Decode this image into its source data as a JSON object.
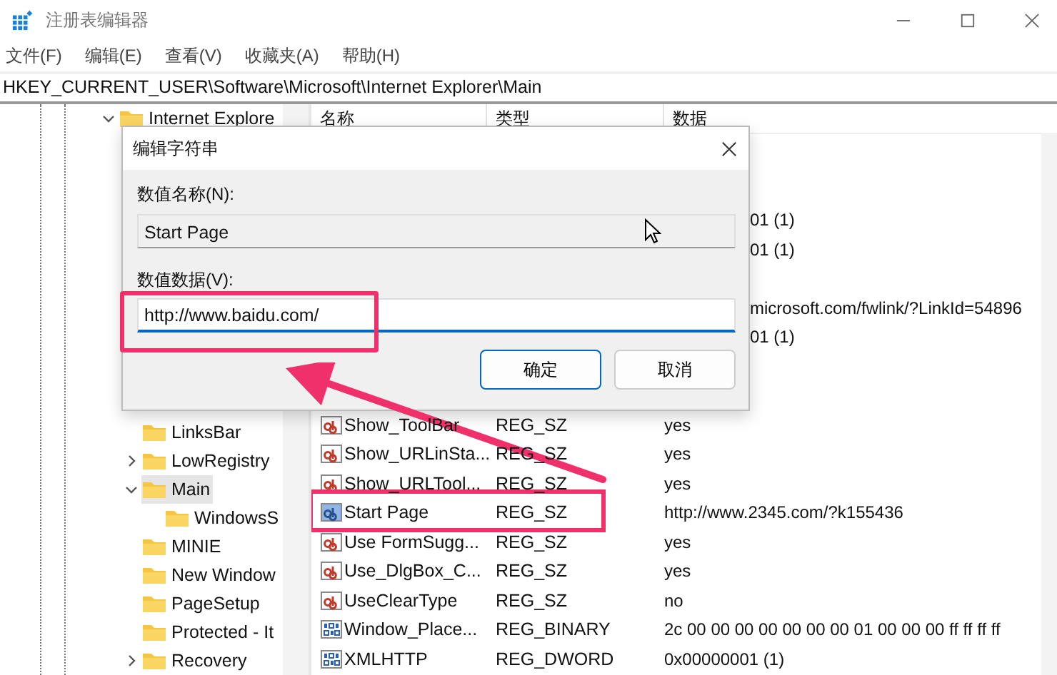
{
  "window": {
    "title": "注册表编辑器"
  },
  "menu": [
    "文件(F)",
    "编辑(E)",
    "查看(V)",
    "收藏夹(A)",
    "帮助(H)"
  ],
  "address": "HKEY_CURRENT_USER\\Software\\Microsoft\\Internet Explorer\\Main",
  "tree": [
    {
      "label": "Internet Explore",
      "expanded": true,
      "selected": false,
      "children": [
        {
          "label": "LinksBar",
          "selected": false
        },
        {
          "label": "LowRegistry",
          "expanded": false,
          "selected": false
        },
        {
          "label": "Main",
          "expanded": true,
          "selected": true,
          "children": [
            {
              "label": "WindowsS",
              "selected": false
            }
          ]
        },
        {
          "label": "MINIE",
          "selected": false
        },
        {
          "label": "New Window",
          "selected": false
        },
        {
          "label": "PageSetup",
          "selected": false
        },
        {
          "label": "Protected - It",
          "selected": false
        },
        {
          "label": "Recovery",
          "expanded": false,
          "selected": false
        }
      ]
    }
  ],
  "table": {
    "columns": [
      "名称",
      "类型",
      "数据"
    ],
    "rows": [
      {
        "kind": "covered"
      },
      {
        "kind": "covered"
      },
      {
        "kind": "partial",
        "data": "01 (1)"
      },
      {
        "kind": "partial",
        "data": "01 (1)"
      },
      {
        "kind": "covered"
      },
      {
        "kind": "partial",
        "data": "microsoft.com/fwlink/?LinkId=54896"
      },
      {
        "kind": "partial",
        "data": "01 (1)"
      },
      {
        "kind": "covered"
      },
      {
        "kind": "covered"
      },
      {
        "kind": "string",
        "name": "Show_ToolBar",
        "type": "REG_SZ",
        "data": "yes"
      },
      {
        "kind": "string",
        "name": "Show_URLinSta...",
        "type": "REG_SZ",
        "data": "yes"
      },
      {
        "kind": "string",
        "name": "Show_URLTool...",
        "type": "REG_SZ",
        "data": "yes"
      },
      {
        "kind": "string",
        "name": "Start Page",
        "type": "REG_SZ",
        "data": "http://www.2345.com/?k155436",
        "highlighted": true
      },
      {
        "kind": "string",
        "name": "Use FormSugg...",
        "type": "REG_SZ",
        "data": "yes"
      },
      {
        "kind": "string",
        "name": "Use_DlgBox_C...",
        "type": "REG_SZ",
        "data": "yes"
      },
      {
        "kind": "string",
        "name": "UseClearType",
        "type": "REG_SZ",
        "data": "no"
      },
      {
        "kind": "binary",
        "name": "Window_Place...",
        "type": "REG_BINARY",
        "data": "2c 00 00 00 00 00 00 00 01 00 00 00 ff ff ff ff"
      },
      {
        "kind": "binary",
        "name": "XMLHTTP",
        "type": "REG_DWORD",
        "data": "0x00000001 (1)"
      }
    ]
  },
  "dialog": {
    "title": "编辑字符串",
    "name_label": "数值名称(N):",
    "name_value": "Start Page",
    "data_label": "数值数据(V):",
    "data_value": "http://www.baidu.com/",
    "buttons": [
      "确定",
      "取消"
    ]
  }
}
